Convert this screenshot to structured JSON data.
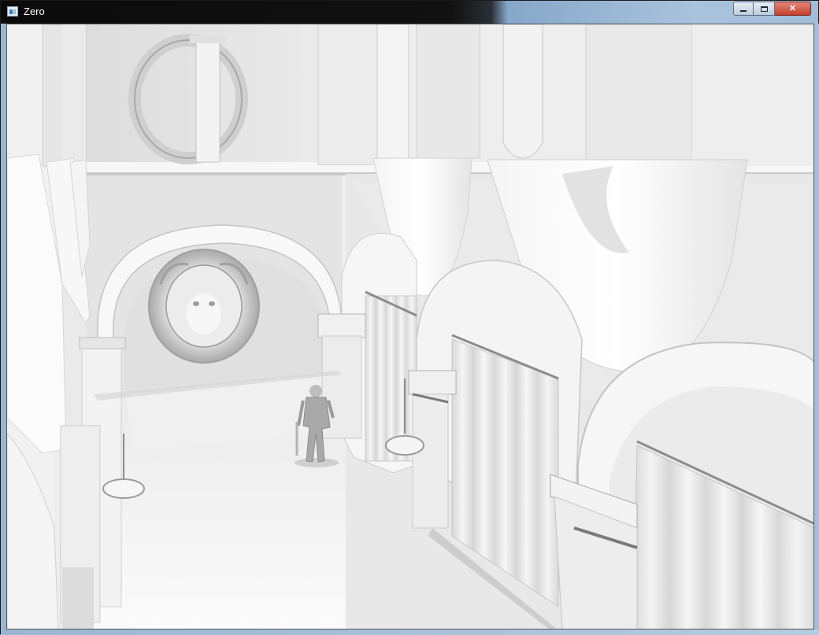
{
  "window": {
    "title": "Zero",
    "icon": "app-window-icon",
    "controls": {
      "minimize": "minimize-icon",
      "maximize": "maximize-icon",
      "close_label": "✕"
    }
  },
  "viewport": {
    "content": "3d-rendered-scene",
    "colors": {
      "background": "#f2f2f2",
      "shadow": "#c8c8c8",
      "deep_shadow": "#7a7a7a"
    }
  }
}
